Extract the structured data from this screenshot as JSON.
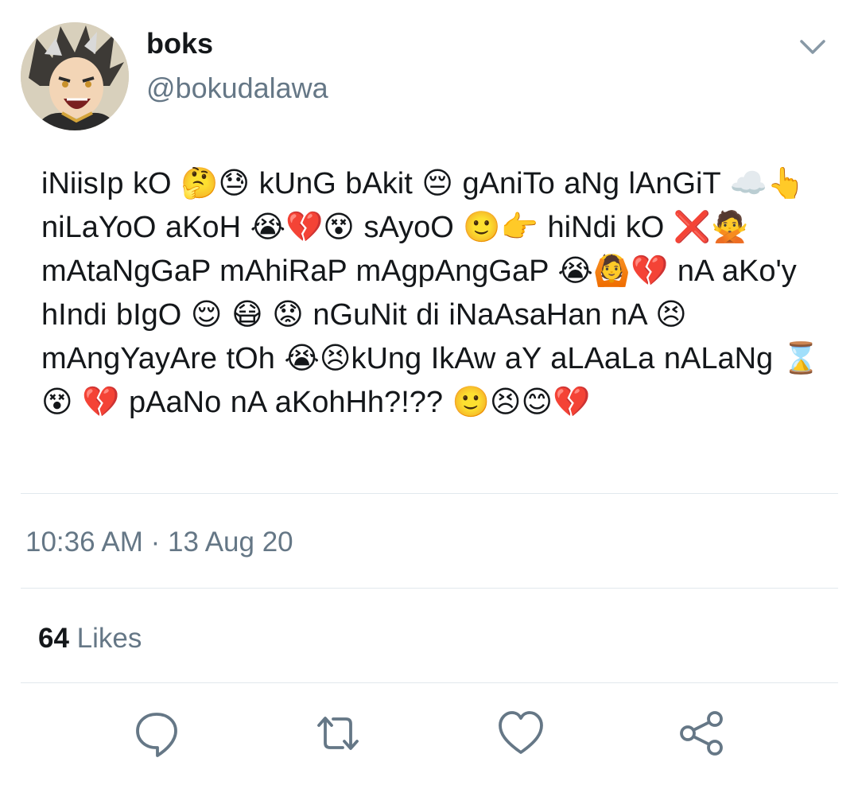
{
  "author": {
    "display_name": "boks",
    "handle": "@bokudalawa",
    "avatar_icon": "anime-avatar"
  },
  "tweet": {
    "text": "iNiisIp kO 🤔😓 kUnG bAkit 😔 gAniTo aNg lAnGiT ☁️👆 niLaYoO aKoH 😭💔😵 sAyoO 🙂👉 hiNdi kO ❌🙅 mAtaNgGaP mAhiRaP mAgpAngGaP 😭🙆💔 nA aKo'y hIndi bIgO 😌 😷 😟 nGuNit di iNaAsaHan nA 😣 mAngYayAre tOh 😭😣kUng IkAw aY aLAaLa nALaNg ⌛😵 💔 pAaNo nA aKohHh?!?? 🙂😣😊💔",
    "timestamp": "10:36 AM · 13 Aug 20",
    "likes_count": "64",
    "likes_label": "Likes"
  },
  "actions": {
    "reply_icon": "reply-icon",
    "retweet_icon": "retweet-icon",
    "like_icon": "heart-icon",
    "share_icon": "share-icon"
  },
  "colors": {
    "text": "#14171a",
    "secondary": "#657786",
    "divider": "#e1e8ed",
    "icon": "#657786"
  }
}
